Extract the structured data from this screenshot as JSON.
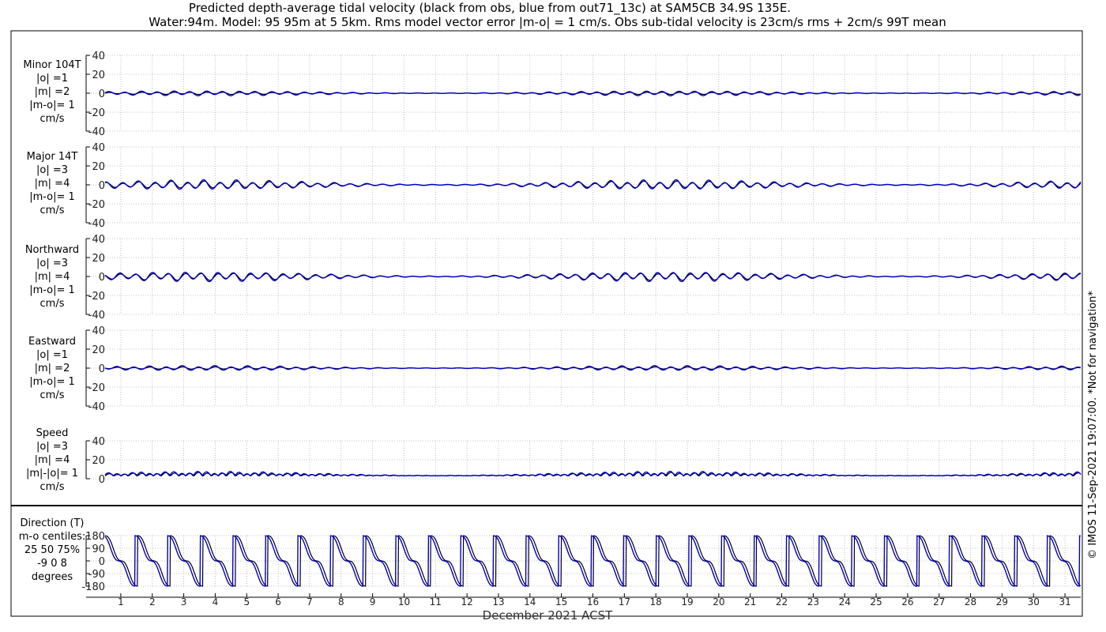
{
  "title_line1": "Predicted depth-average tidal velocity (black from obs, blue from out71_13c) at SAM5CB 34.9S 135E.",
  "title_line2": "Water:94m. Model: 95 95m at 5 5km. Rms model vector error |m-o| = 1 cm/s. Obs sub-tidal velocity is 23cm/s rms + 2cm/s 99T mean",
  "xlabel": "December 2021 ACST",
  "side_note": "© IMOS 11-Sep-2021 19:07:00. *Not for navigation*",
  "colors": {
    "obs": "#000000",
    "model": "#0000cc",
    "grid": "#b0b0b0"
  },
  "chart_data": [
    {
      "type": "line",
      "panel_label": [
        "Minor 104T",
        "|o| =1",
        "|m| =2",
        "|m-o|= 1",
        "cm/s"
      ],
      "ylim": [
        -40,
        40
      ],
      "yticks": [
        -40,
        -20,
        0,
        20,
        40
      ],
      "xlim": [
        0,
        31
      ],
      "series": [
        {
          "name": "obs",
          "amplitude": 1,
          "offset": 0
        },
        {
          "name": "model",
          "amplitude": 2,
          "offset": 0
        }
      ]
    },
    {
      "type": "line",
      "panel_label": [
        "Major 14T",
        "|o| =3",
        "|m| =4",
        "|m-o|= 1",
        "cm/s"
      ],
      "ylim": [
        -40,
        40
      ],
      "yticks": [
        -40,
        -20,
        0,
        20,
        40
      ],
      "xlim": [
        0,
        31
      ],
      "series": [
        {
          "name": "obs",
          "amplitude": 3,
          "offset": 0
        },
        {
          "name": "model",
          "amplitude": 4,
          "offset": 0
        }
      ]
    },
    {
      "type": "line",
      "panel_label": [
        "Northward",
        "|o| =3",
        "|m| =4",
        "|m-o|= 1",
        "cm/s"
      ],
      "ylim": [
        -40,
        40
      ],
      "yticks": [
        -40,
        -20,
        0,
        20,
        40
      ],
      "xlim": [
        0,
        31
      ],
      "series": [
        {
          "name": "obs",
          "amplitude": 3,
          "offset": 0
        },
        {
          "name": "model",
          "amplitude": 4,
          "offset": 0
        }
      ]
    },
    {
      "type": "line",
      "panel_label": [
        "Eastward",
        "|o| =1",
        "|m| =2",
        "|m-o|= 1",
        "cm/s"
      ],
      "ylim": [
        -40,
        40
      ],
      "yticks": [
        -40,
        -20,
        0,
        20,
        40
      ],
      "xlim": [
        0,
        31
      ],
      "series": [
        {
          "name": "obs",
          "amplitude": 1,
          "offset": 0
        },
        {
          "name": "model",
          "amplitude": 2,
          "offset": 0
        }
      ]
    },
    {
      "type": "line",
      "panel_label": [
        "Speed",
        "|o| =3",
        "|m| =4",
        "|m|-|o|= 1",
        "cm/s"
      ],
      "ylim": [
        0,
        40
      ],
      "yticks": [
        0,
        20,
        40
      ],
      "xlim": [
        0,
        31
      ],
      "series": [
        {
          "name": "obs",
          "amplitude": 3,
          "offset": 3
        },
        {
          "name": "model",
          "amplitude": 4,
          "offset": 3
        }
      ]
    },
    {
      "type": "line",
      "panel_label": [
        "Direction (T)",
        "m-o centiles:",
        "25  50  75%",
        "-9  0  8",
        "degrees"
      ],
      "ylim": [
        -180,
        180
      ],
      "yticks": [
        -180,
        -90,
        0,
        90,
        180
      ],
      "xlim": [
        0,
        31
      ],
      "series": [
        {
          "name": "obs"
        },
        {
          "name": "model"
        }
      ]
    }
  ],
  "x_tick_labels": [
    "1",
    "2",
    "3",
    "4",
    "5",
    "6",
    "7",
    "8",
    "9",
    "10",
    "11",
    "12",
    "13",
    "14",
    "15",
    "16",
    "17",
    "18",
    "19",
    "20",
    "21",
    "22",
    "23",
    "24",
    "25",
    "26",
    "27",
    "28",
    "29",
    "30",
    "31"
  ]
}
